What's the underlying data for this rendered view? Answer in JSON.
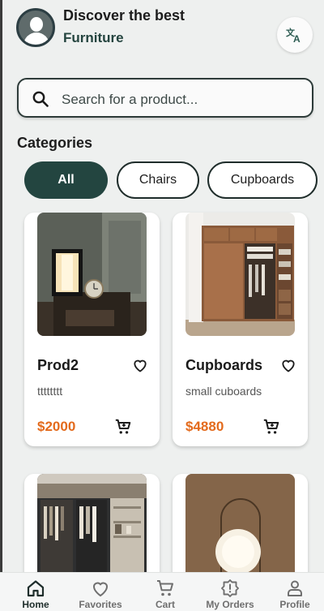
{
  "header": {
    "greeting_line1": "Discover the best",
    "greeting_line2": "Furniture",
    "avatar_icon": "user-avatar-icon",
    "translate_icon": "translate-icon"
  },
  "search": {
    "placeholder": "Search for a product..."
  },
  "categories": {
    "title": "Categories",
    "chips": [
      {
        "label": "All",
        "selected": true
      },
      {
        "label": "Chairs",
        "selected": false
      },
      {
        "label": "Cupboards",
        "selected": false
      }
    ]
  },
  "products": [
    {
      "name": "Prod2",
      "description": "tttttttt",
      "price": "$2000",
      "image": "lamp-nightstand"
    },
    {
      "name": "Cupboards",
      "description": "small cuboards",
      "price": "$4880",
      "image": "wooden-wardrobe"
    },
    {
      "image": "dark-closet"
    },
    {
      "image": "globe-lamp"
    }
  ],
  "bottom_nav": [
    {
      "label": "Home",
      "icon": "home-icon",
      "active": true
    },
    {
      "label": "Favorites",
      "icon": "heart-icon",
      "active": false
    },
    {
      "label": "Cart",
      "icon": "cart-icon",
      "active": false
    },
    {
      "label": "My Orders",
      "icon": "orders-alert-icon",
      "active": false
    },
    {
      "label": "Profile",
      "icon": "profile-icon",
      "active": false
    }
  ],
  "colors": {
    "primary": "#234540",
    "price": "#e36a1c",
    "background": "#eef0ef"
  }
}
